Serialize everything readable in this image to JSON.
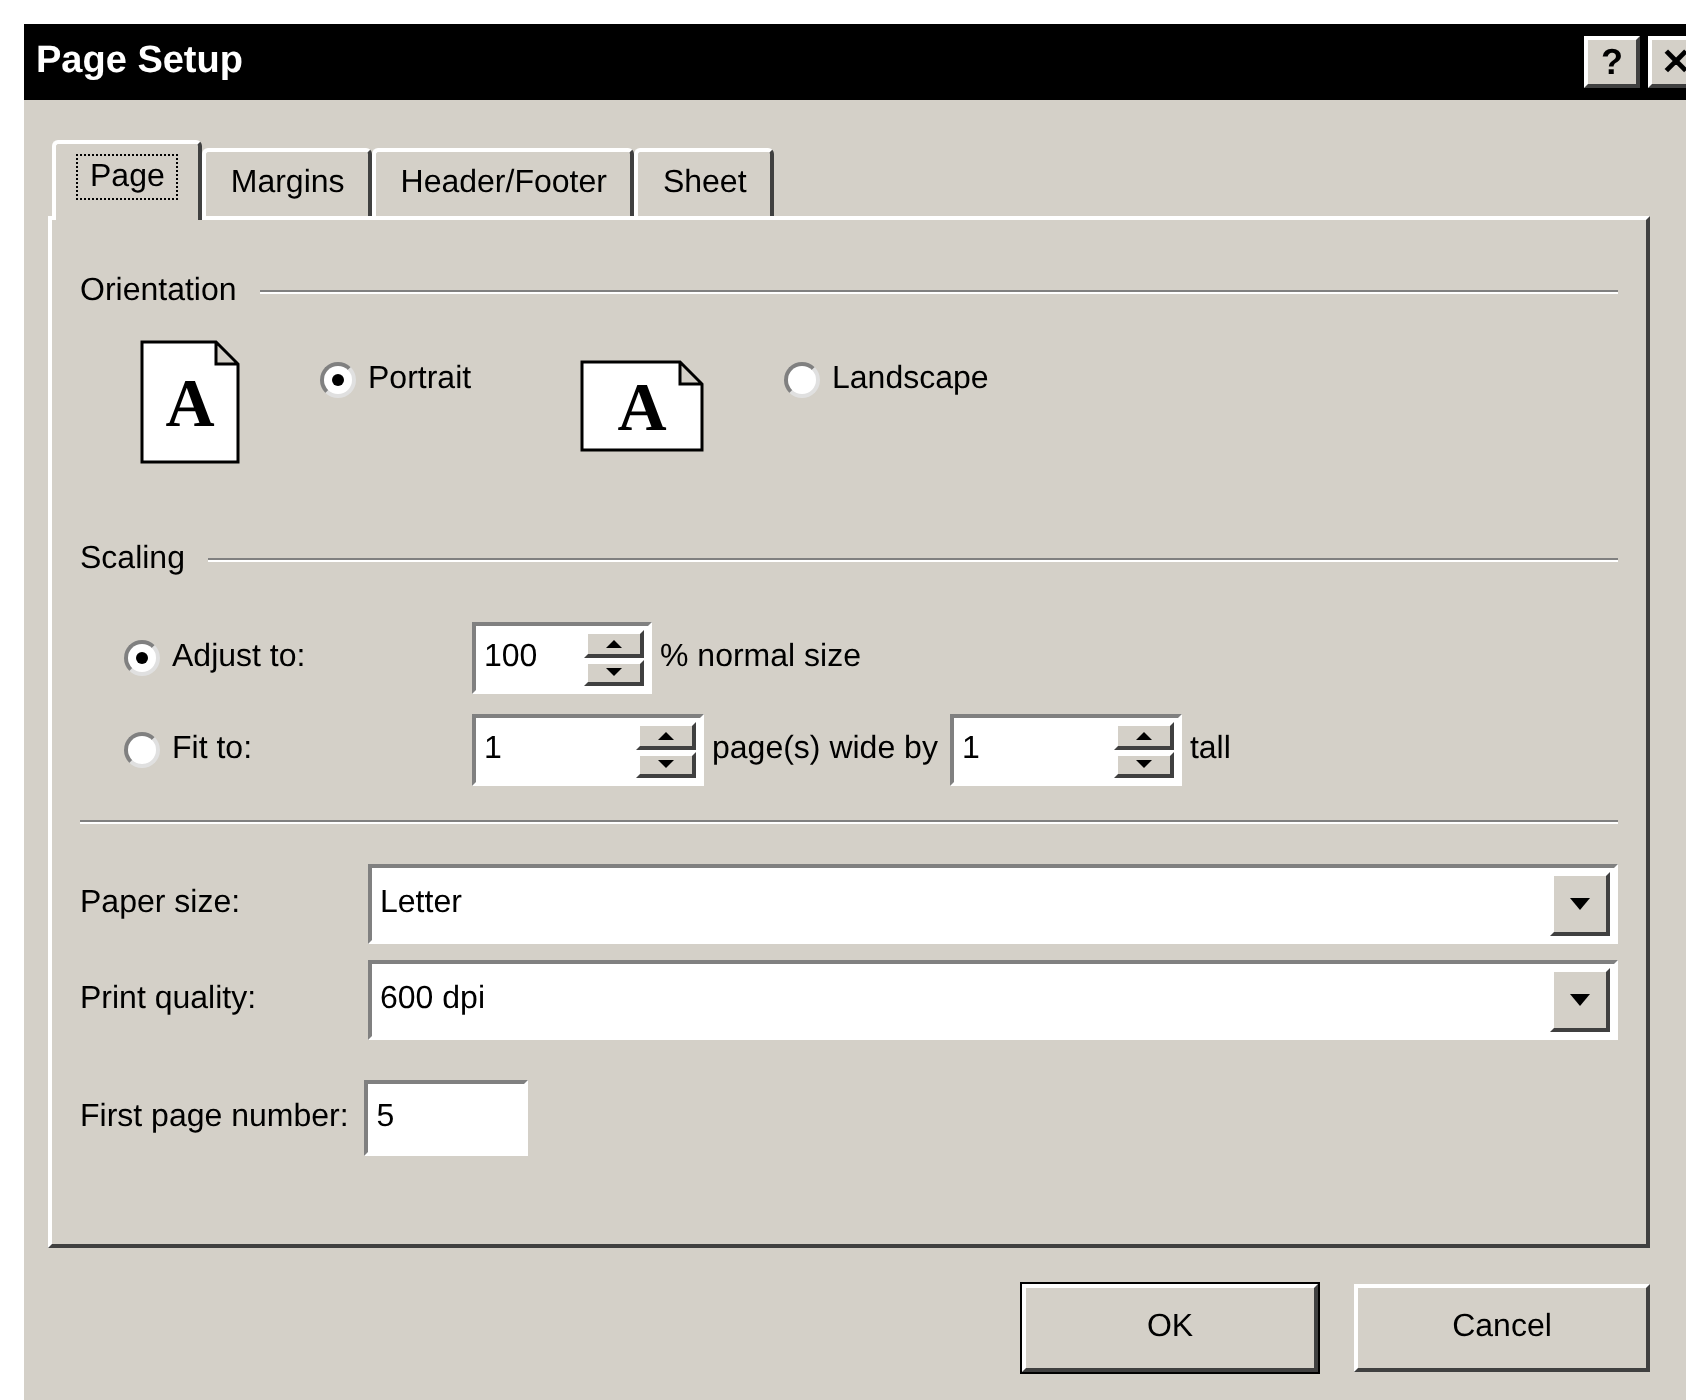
{
  "window": {
    "title": "Page Setup",
    "title_buttons": [
      "?",
      "✕"
    ]
  },
  "tabs": [
    {
      "label": "Page",
      "selected": true
    },
    {
      "label": "Margins",
      "selected": false
    },
    {
      "label": "Header/Footer",
      "selected": false
    },
    {
      "label": "Sheet",
      "selected": false
    }
  ],
  "orientation": {
    "heading": "Orientation",
    "options": [
      {
        "label": "Portrait",
        "glyph": "A",
        "kind": "portrait",
        "selected": true
      },
      {
        "label": "Landscape",
        "glyph": "A",
        "kind": "landscape",
        "selected": false
      }
    ]
  },
  "scaling": {
    "heading": "Scaling",
    "options": [
      {
        "label": "Adjust to:",
        "selected": true,
        "fields": [
          {
            "value": "100",
            "suffix": "% normal size",
            "kind": "short"
          }
        ]
      },
      {
        "label": "Fit to:",
        "selected": false,
        "fields": [
          {
            "value": "1",
            "suffix": "page(s) wide by",
            "kind": "long"
          },
          {
            "value": "1",
            "suffix": "tall",
            "kind": "long"
          }
        ]
      }
    ]
  },
  "dropdowns": [
    {
      "label": "Paper size:",
      "value": "Letter"
    },
    {
      "label": "Print quality:",
      "value": "600 dpi"
    }
  ],
  "first_page_number": {
    "label": "First page number:",
    "value": "5"
  },
  "buttons": [
    {
      "label": "OK",
      "default": true
    },
    {
      "label": "Cancel",
      "default": false
    }
  ]
}
